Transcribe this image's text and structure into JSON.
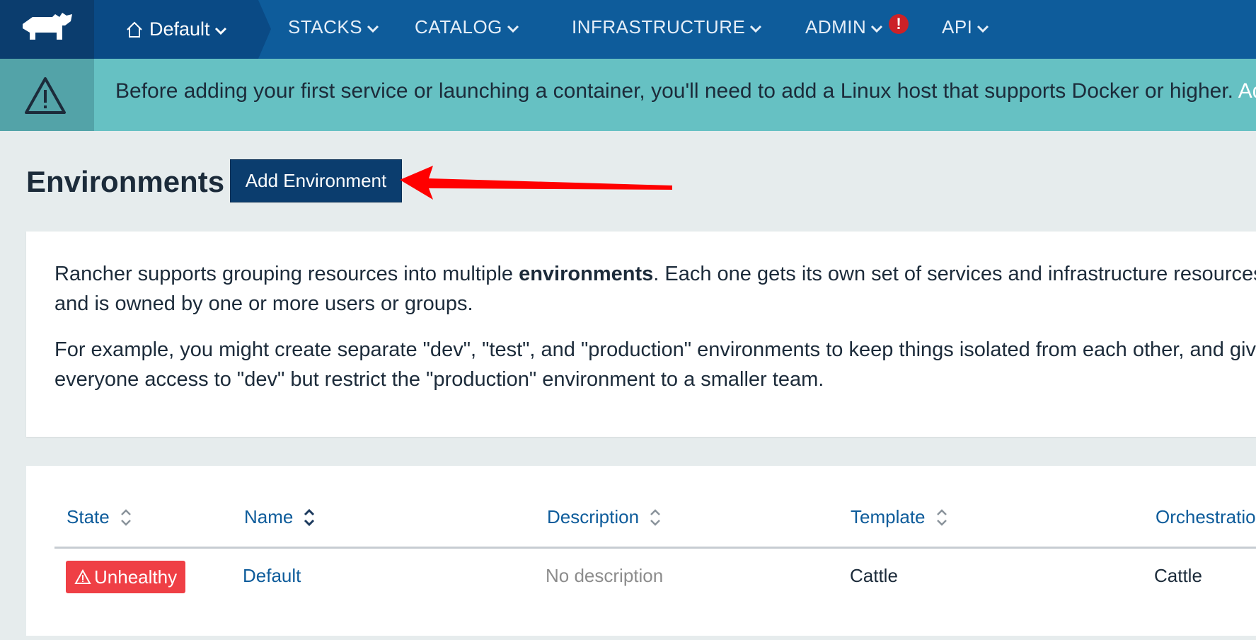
{
  "nav": {
    "environment_label": "Default",
    "items": [
      {
        "label": "STACKS"
      },
      {
        "label": "CATALOG"
      },
      {
        "label": "INFRASTRUCTURE"
      },
      {
        "label": "ADMIN"
      },
      {
        "label": "API"
      }
    ],
    "admin_alert": "!"
  },
  "banner": {
    "text": "Before adding your first service or launching a container, you'll need to add a Linux host that supports Docker or higher. ",
    "link": "Add a"
  },
  "header": {
    "title": "Environments",
    "add_button_label": "Add Environment"
  },
  "info": {
    "p1_before": "Rancher supports grouping resources into multiple ",
    "p1_bold": "environments",
    "p1_after": ". Each one gets its own set of services and infrastructure resources, and is owned by one or more users or groups.",
    "p2": "For example, you might create separate \"dev\", \"test\", and \"production\" environments to keep things isolated from each other, and give everyone access to \"dev\" but restrict the \"production\" environment to a smaller team."
  },
  "table": {
    "columns": [
      "State",
      "Name",
      "Description",
      "Template",
      "Orchestration"
    ],
    "rows": [
      {
        "state": "Unhealthy",
        "name": "Default",
        "description": "No description",
        "template": "Cattle",
        "orchestration": "Cattle"
      }
    ]
  },
  "colors": {
    "nav_bg": "#0e5c9b",
    "banner_bg": "#66c1c3",
    "button_bg": "#0b3d6e",
    "unhealthy": "#ef3f45",
    "arrow": "#ff0000"
  }
}
